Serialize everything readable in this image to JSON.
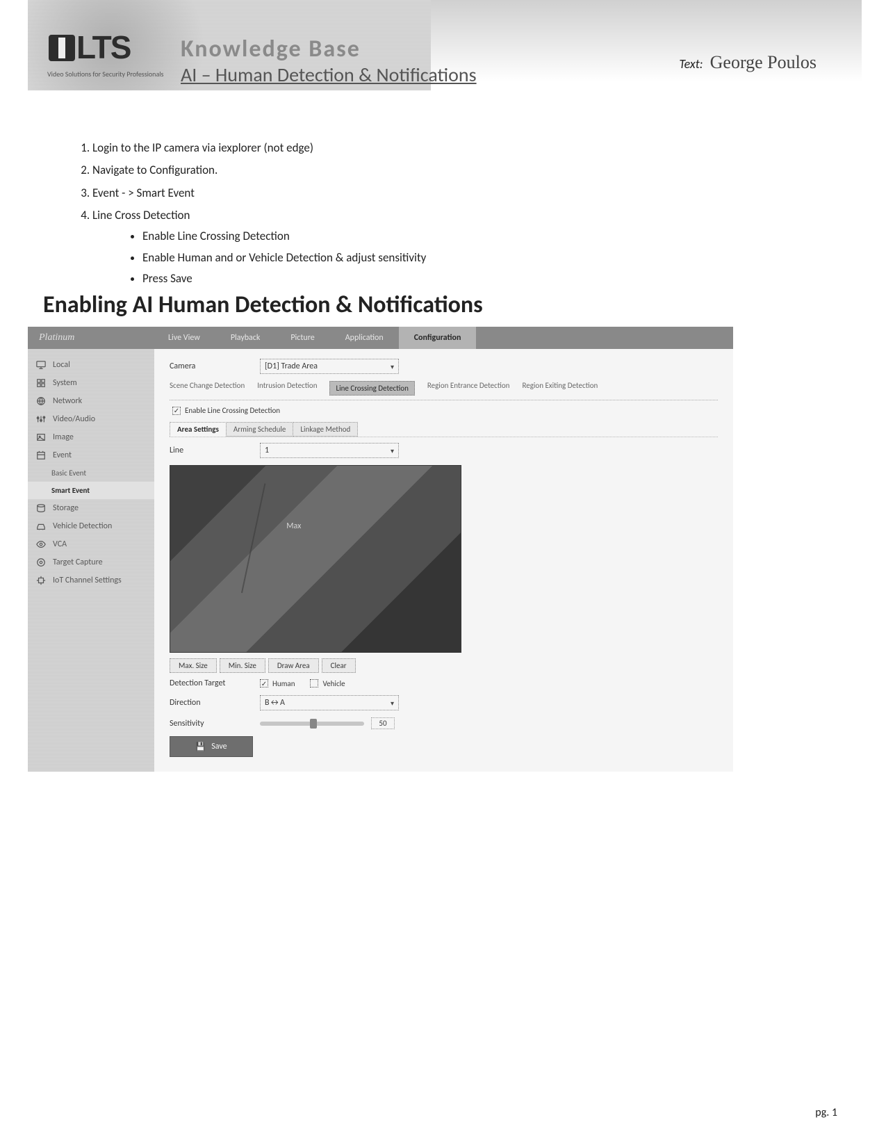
{
  "header": {
    "logo_text": "LTS",
    "logo_tag": "Video Solutions for Security Professionals",
    "kb": "Knowledge Base",
    "subject": "AI – Human Detection & Notifications",
    "author_label": "Text:",
    "author_name": "George Poulos"
  },
  "steps": {
    "s1": "Login to the IP camera via iexplorer (not edge)",
    "s2": "Navigate to Configuration.",
    "s3": "Event - > Smart Event",
    "s4": "Line Cross Detection",
    "b1": "Enable Line Crossing Detection",
    "b2": "Enable Human and or Vehicle Detection & adjust sensitivity",
    "b3": "Press Save"
  },
  "h1": "Enabling AI Human Detection & Notifications",
  "app": {
    "brand": "Platinum",
    "tabs": {
      "live": "Live View",
      "playback": "Playback",
      "picture": "Picture",
      "application": "Application",
      "configuration": "Configuration"
    },
    "sidebar": {
      "local": "Local",
      "system": "System",
      "network": "Network",
      "videoaudio": "Video/Audio",
      "image": "Image",
      "event": "Event",
      "basic_event": "Basic Event",
      "smart_event": "Smart Event",
      "storage": "Storage",
      "vehicle": "Vehicle Detection",
      "vca": "VCA",
      "target": "Target Capture",
      "iot": "IoT Channel Settings"
    },
    "camera_label": "Camera",
    "camera_value": "[D1] Trade Area",
    "detect_tabs": {
      "scene": "Scene Change Detection",
      "intrusion": "Intrusion Detection",
      "line": "Line Crossing Detection",
      "region_in": "Region Entrance Detection",
      "region_out": "Region Exiting Detection"
    },
    "enable_chk": "Enable Line Crossing Detection",
    "cfg_tabs": {
      "area": "Area Settings",
      "arming": "Arming Schedule",
      "linkage": "Linkage Method"
    },
    "line_label": "Line",
    "line_value": "1",
    "preview_note": "Max",
    "btns": {
      "max": "Max. Size",
      "min": "Min. Size",
      "draw": "Draw Area",
      "clear": "Clear"
    },
    "target_label": "Detection Target",
    "target_human": "Human",
    "target_vehicle": "Vehicle",
    "direction_label": "Direction",
    "direction_value": "B↔A",
    "sens_label": "Sensitivity",
    "sens_value": "50",
    "save": "Save"
  },
  "footer": "pg. 1"
}
